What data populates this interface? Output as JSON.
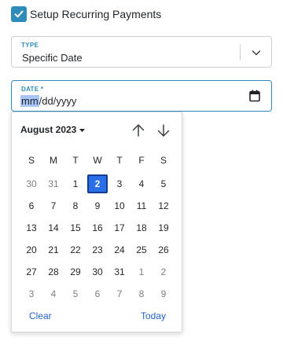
{
  "recurring": {
    "label": "Setup Recurring Payments",
    "checked": true
  },
  "type_field": {
    "label": "TYPE",
    "value": "Specific Date"
  },
  "date_field": {
    "label": "DATE *",
    "value_segment_mm": "mm",
    "value_rest": "/dd/yyyy"
  },
  "calendar": {
    "month_label": "August 2023",
    "weekdays": [
      "S",
      "M",
      "T",
      "W",
      "T",
      "F",
      "S"
    ],
    "weeks": [
      [
        {
          "d": "30",
          "o": true
        },
        {
          "d": "31",
          "o": true
        },
        {
          "d": "1"
        },
        {
          "d": "2",
          "sel": true
        },
        {
          "d": "3"
        },
        {
          "d": "4"
        },
        {
          "d": "5"
        }
      ],
      [
        {
          "d": "6"
        },
        {
          "d": "7"
        },
        {
          "d": "8"
        },
        {
          "d": "9"
        },
        {
          "d": "10"
        },
        {
          "d": "11"
        },
        {
          "d": "12"
        }
      ],
      [
        {
          "d": "13"
        },
        {
          "d": "14"
        },
        {
          "d": "15"
        },
        {
          "d": "16"
        },
        {
          "d": "17"
        },
        {
          "d": "18"
        },
        {
          "d": "19"
        }
      ],
      [
        {
          "d": "20"
        },
        {
          "d": "21"
        },
        {
          "d": "22"
        },
        {
          "d": "23"
        },
        {
          "d": "24"
        },
        {
          "d": "25"
        },
        {
          "d": "26"
        }
      ],
      [
        {
          "d": "27"
        },
        {
          "d": "28"
        },
        {
          "d": "29"
        },
        {
          "d": "30"
        },
        {
          "d": "31"
        },
        {
          "d": "1",
          "o": true
        },
        {
          "d": "2",
          "o": true
        }
      ],
      [
        {
          "d": "3",
          "o": true
        },
        {
          "d": "4",
          "o": true
        },
        {
          "d": "5",
          "o": true
        },
        {
          "d": "6",
          "o": true
        },
        {
          "d": "7",
          "o": true
        },
        {
          "d": "8",
          "o": true
        },
        {
          "d": "9",
          "o": true
        }
      ]
    ],
    "clear_label": "Clear",
    "today_label": "Today"
  },
  "colors": {
    "accent": "#2d8cb9",
    "selected_day": "#2b6fe6",
    "link": "#2563c5"
  },
  "icons": {
    "checkbox": "check-icon",
    "select": "chevron-down-icon",
    "date": "calendar-icon",
    "month": "caret-down-icon",
    "prev": "arrow-up-icon",
    "next": "arrow-down-icon"
  }
}
